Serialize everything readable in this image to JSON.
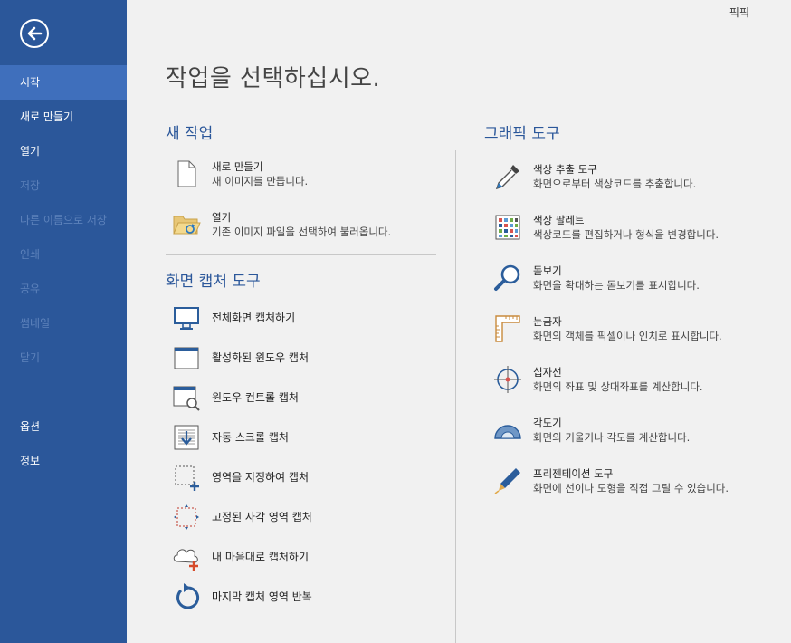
{
  "app": {
    "name": "픽픽"
  },
  "sidebar": {
    "items": [
      {
        "label": "시작",
        "state": "active"
      },
      {
        "label": "새로 만들기",
        "state": "normal"
      },
      {
        "label": "열기",
        "state": "normal"
      },
      {
        "label": "저장",
        "state": "disabled"
      },
      {
        "label": "다른 이름으로 저장",
        "state": "disabled"
      },
      {
        "label": "인쇄",
        "state": "disabled"
      },
      {
        "label": "공유",
        "state": "disabled"
      },
      {
        "label": "썸네일",
        "state": "disabled"
      },
      {
        "label": "닫기",
        "state": "disabled"
      }
    ],
    "bottom_items": [
      {
        "label": "옵션"
      },
      {
        "label": "정보"
      }
    ]
  },
  "main": {
    "title": "작업을 선택하십시오.",
    "new_task": {
      "title": "새 작업",
      "items": [
        {
          "title": "새로 만들기",
          "desc": "새 이미지를 만듭니다.",
          "icon": "new-file-icon"
        },
        {
          "title": "열기",
          "desc": "기존 이미지 파일을 선택하여 불러옵니다.",
          "icon": "open-folder-icon"
        }
      ]
    },
    "capture": {
      "title": "화면 캡처 도구",
      "items": [
        {
          "label": "전체화면 캡처하기",
          "icon": "monitor-icon"
        },
        {
          "label": "활성화된 윈도우 캡처",
          "icon": "window-icon"
        },
        {
          "label": "윈도우 컨트롤 캡처",
          "icon": "window-control-icon"
        },
        {
          "label": "자동 스크롤 캡처",
          "icon": "scroll-capture-icon"
        },
        {
          "label": "영역을 지정하여 캡처",
          "icon": "region-select-icon"
        },
        {
          "label": "고정된 사각 영역 캡처",
          "icon": "fixed-region-icon"
        },
        {
          "label": "내 마음대로 캡처하기",
          "icon": "freehand-cloud-icon"
        },
        {
          "label": "마지막 캡처 영역 반복",
          "icon": "repeat-icon"
        }
      ]
    },
    "graphic": {
      "title": "그래픽 도구",
      "items": [
        {
          "title": "색상 추출 도구",
          "desc": "화면으로부터 색상코드를 추출합니다.",
          "icon": "eyedropper-icon"
        },
        {
          "title": "색상 팔레트",
          "desc": "색상코드를 편집하거나 형식을 변경합니다.",
          "icon": "palette-icon"
        },
        {
          "title": "돋보기",
          "desc": "화면을 확대하는 돋보기를 표시합니다.",
          "icon": "magnifier-icon"
        },
        {
          "title": "눈금자",
          "desc": "화면의 객체를 픽셀이나 인치로 표시합니다.",
          "icon": "ruler-icon"
        },
        {
          "title": "십자선",
          "desc": "화면의 좌표 및 상대좌표를 계산합니다.",
          "icon": "crosshair-icon"
        },
        {
          "title": "각도기",
          "desc": "화면의 기울기나 각도를 계산합니다.",
          "icon": "protractor-icon"
        },
        {
          "title": "프리젠테이션 도구",
          "desc": "화면에 선이나 도형을 직접 그릴 수 있습니다.",
          "icon": "pen-icon"
        }
      ]
    }
  }
}
